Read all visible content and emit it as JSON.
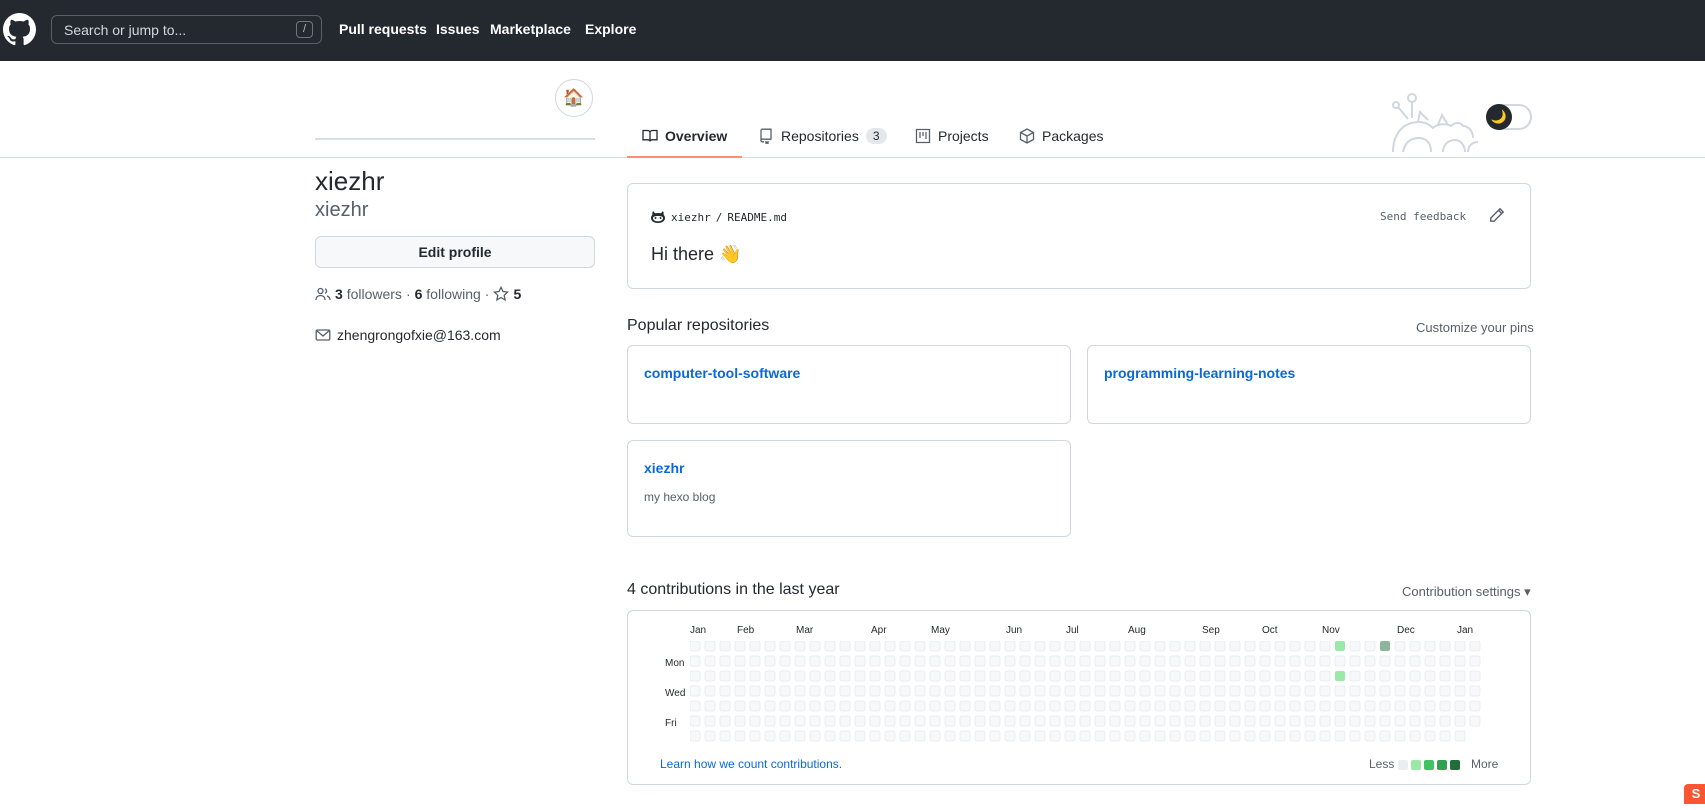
{
  "header": {
    "search_placeholder": "Search or jump to...",
    "slash_key": "/",
    "nav": [
      "Pull requests",
      "Issues",
      "Marketplace",
      "Explore"
    ]
  },
  "profile": {
    "avatar_emoji": "🏠",
    "display_name": "xiezhr",
    "username": "xiezhr",
    "edit_button": "Edit profile",
    "followers_count": "3",
    "followers_label": "followers",
    "following_count": "6",
    "following_label": "following",
    "stars_count": "5",
    "email": "zhengrongofxie@163.com"
  },
  "tabs": [
    {
      "label": "Overview",
      "icon": "book-icon"
    },
    {
      "label": "Repositories",
      "icon": "repo-icon",
      "count": "3"
    },
    {
      "label": "Projects",
      "icon": "project-icon"
    },
    {
      "label": "Packages",
      "icon": "package-icon"
    }
  ],
  "theme_toggle": {
    "icon": "🌙"
  },
  "readme": {
    "owner": "xiezhr",
    "separator": "/",
    "file": "README.md",
    "send_feedback": "Send feedback",
    "greeting": "Hi there",
    "wave": "👋"
  },
  "popular": {
    "title": "Popular repositories",
    "customize": "Customize your pins",
    "repos": [
      {
        "name": "computer-tool-software",
        "desc": ""
      },
      {
        "name": "programming-learning-notes",
        "desc": ""
      },
      {
        "name": "xiezhr",
        "desc": "my hexo blog"
      }
    ]
  },
  "contributions": {
    "title": "4 contributions in the last year",
    "settings": "Contribution settings",
    "months": [
      "Jan",
      "Feb",
      "Mar",
      "Apr",
      "May",
      "Jun",
      "Jul",
      "Aug",
      "Sep",
      "Oct",
      "Nov",
      "Dec",
      "Jan"
    ],
    "days": [
      "Mon",
      "Wed",
      "Fri"
    ],
    "learn_link": "Learn how we count contributions.",
    "legend_less": "Less",
    "legend_more": "More",
    "colors": {
      "empty": "#ebedf0",
      "l1": "#9be9a8",
      "l2": "#40c463",
      "l3": "#30a14e",
      "l4": "#216e39",
      "grey": "#8fb49c"
    },
    "active_cells": [
      {
        "week": 43,
        "day": 0,
        "level": "l1"
      },
      {
        "week": 46,
        "day": 0,
        "level": "grey"
      },
      {
        "week": 43,
        "day": 2,
        "level": "l1"
      }
    ]
  },
  "corner_badge": "S"
}
